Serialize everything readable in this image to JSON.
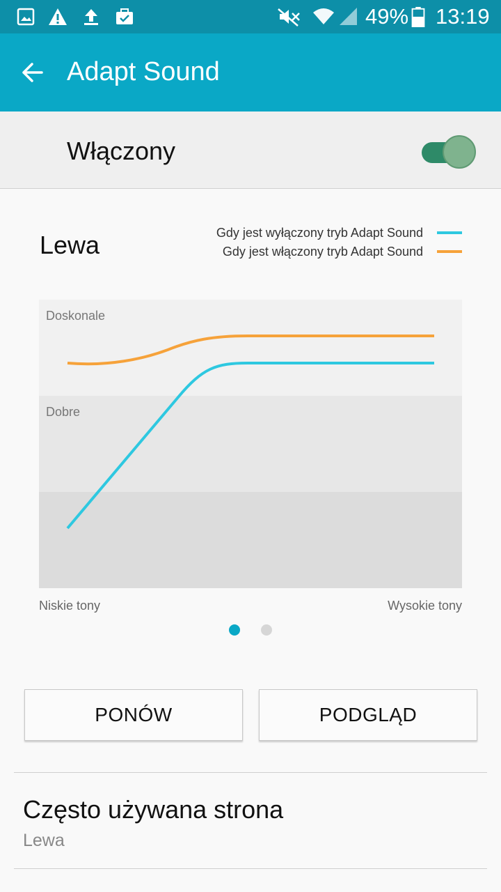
{
  "status_bar": {
    "battery_percent": "49%",
    "time": "13:19",
    "icons": [
      "gallery-icon",
      "warning-icon",
      "upload-icon",
      "briefcase-icon",
      "mute-icon",
      "wifi-icon",
      "signal-icon",
      "battery-icon"
    ]
  },
  "app_bar": {
    "title": "Adapt Sound",
    "back_icon": "arrow-back-icon"
  },
  "toggle": {
    "label": "Włączony",
    "state": "on"
  },
  "chart_section": {
    "side_title": "Lewa",
    "page_indicator": {
      "count": 2,
      "active": 1
    }
  },
  "chart_data": {
    "type": "line",
    "xlabel_left": "Niskie tony",
    "xlabel_right": "Wysokie tony",
    "bands": [
      "Doskonale",
      "Dobre",
      ""
    ],
    "series": [
      {
        "name": "Gdy jest wyłączony tryb Adapt Sound",
        "color": "#2ec8e0"
      },
      {
        "name": "Gdy jest włączony tryb Adapt Sound",
        "color": "#f6a23a"
      }
    ]
  },
  "buttons": {
    "retry": "PONÓW",
    "preview": "PODGLĄD"
  },
  "preference": {
    "title": "Często używana strona",
    "value": "Lewa"
  },
  "colors": {
    "status_bar": "#0d8fa8",
    "app_bar": "#0aa8c6",
    "accent_dot": "#0aa8c6",
    "switch_on": "#2e8a68"
  }
}
